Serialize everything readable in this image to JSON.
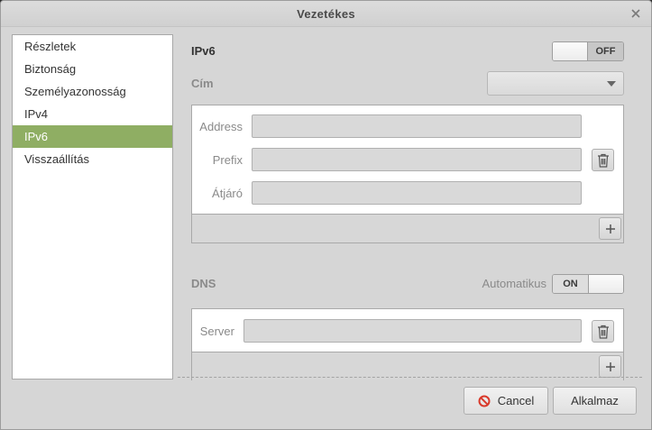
{
  "window": {
    "title": "Vezetékes"
  },
  "sidebar": {
    "items": [
      {
        "label": "Részletek"
      },
      {
        "label": "Biztonság"
      },
      {
        "label": "Személyazonosság"
      },
      {
        "label": "IPv4"
      },
      {
        "label": "IPv6",
        "active": true
      },
      {
        "label": "Visszaállítás"
      }
    ]
  },
  "ipv6": {
    "heading": "IPv6",
    "toggle_state": "OFF",
    "method_label": "Cím",
    "method_value": ""
  },
  "address_panel": {
    "address_label": "Address",
    "address_value": "",
    "prefix_label": "Prefix",
    "prefix_value": "",
    "gateway_label": "Átjáró",
    "gateway_value": ""
  },
  "dns": {
    "heading": "DNS",
    "auto_label": "Automatikus",
    "toggle_state": "ON",
    "server_label": "Server",
    "server_value": ""
  },
  "buttons": {
    "cancel_label": "Cancel",
    "apply_label": "Alkalmaz"
  },
  "colors": {
    "accent": "#8fae63",
    "cancel_icon": "#d93a2b"
  }
}
